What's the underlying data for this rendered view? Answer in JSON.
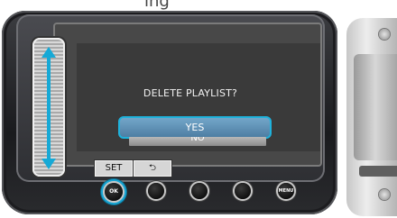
{
  "header": {
    "cut_text": "ing"
  },
  "dialog": {
    "prompt": "DELETE PLAYLIST?",
    "options": [
      {
        "label": "YES",
        "selected": true
      },
      {
        "label": "NO",
        "selected": false
      }
    ]
  },
  "controls": {
    "set_label": "SET",
    "back_symbol": "⮌",
    "ok_label": "OK",
    "menu_label": "MENU"
  },
  "colors": {
    "accent": "#1fb2dc",
    "selected_fill": "#5f90b6",
    "unselected_fill": "#a3a3a3",
    "screen": "#3a3a3a"
  },
  "icons": [
    "up-arrow-icon",
    "down-arrow-icon",
    "back-arrow-icon",
    "ok-button-icon",
    "menu-button-icon"
  ]
}
